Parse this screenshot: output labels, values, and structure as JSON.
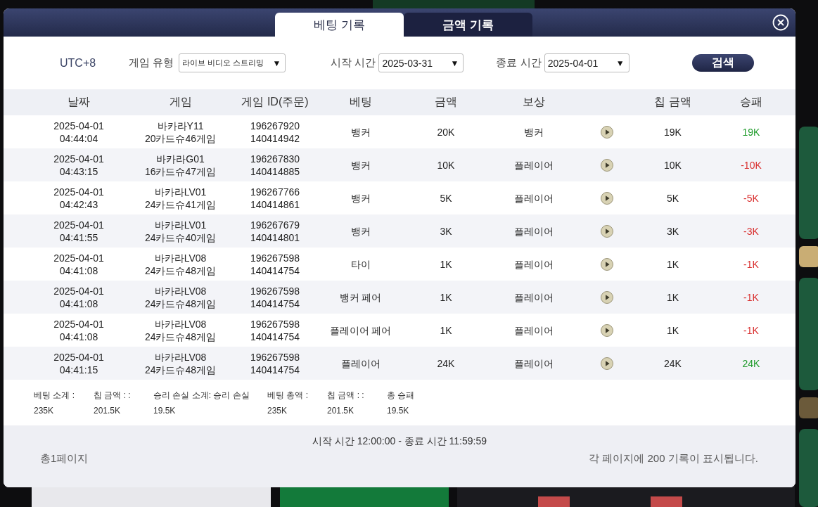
{
  "tabs": [
    {
      "label": "베팅 기록",
      "selected": true
    },
    {
      "label": "금액 기록",
      "selected": false
    }
  ],
  "filters": {
    "timezone": "UTC+8",
    "game_type_label": "게임 유형",
    "game_type": "라이브 비디오 스트리밍",
    "start_label": "시작 시간",
    "start_date": "2025-03-31",
    "end_label": "종료 시간",
    "end_date": "2025-04-01",
    "search_button": "검색",
    "dropdown_arrow": "▼"
  },
  "table": {
    "columns": [
      "날짜",
      "게임",
      "게임 ID(주문)",
      "베팅",
      "금액",
      "보상",
      "칩 금액",
      "승패"
    ],
    "rows": [
      {
        "date": "2025-04-01",
        "time": "04:44:04",
        "game": "바카라Y11",
        "shoe": "20카드슈46게임",
        "id1": "196267920",
        "id2": "140414942",
        "bet": "뱅커",
        "amount": "20K",
        "result": "뱅커",
        "chip": "19K",
        "win_loss": "19K",
        "win": true
      },
      {
        "date": "2025-04-01",
        "time": "04:43:15",
        "game": "바카라G01",
        "shoe": "16카드슈47게임",
        "id1": "196267830",
        "id2": "140414885",
        "bet": "뱅커",
        "amount": "10K",
        "result": "플레이어",
        "chip": "10K",
        "win_loss": "-10K",
        "win": false
      },
      {
        "date": "2025-04-01",
        "time": "04:42:43",
        "game": "바카라LV01",
        "shoe": "24카드슈41게임",
        "id1": "196267766",
        "id2": "140414861",
        "bet": "뱅커",
        "amount": "5K",
        "result": "플레이어",
        "chip": "5K",
        "win_loss": "-5K",
        "win": false
      },
      {
        "date": "2025-04-01",
        "time": "04:41:55",
        "game": "바카라LV01",
        "shoe": "24카드슈40게임",
        "id1": "196267679",
        "id2": "140414801",
        "bet": "뱅커",
        "amount": "3K",
        "result": "플레이어",
        "chip": "3K",
        "win_loss": "-3K",
        "win": false
      },
      {
        "date": "2025-04-01",
        "time": "04:41:08",
        "game": "바카라LV08",
        "shoe": "24카드슈48게임",
        "id1": "196267598",
        "id2": "140414754",
        "bet": "타이",
        "amount": "1K",
        "result": "플레이어",
        "chip": "1K",
        "win_loss": "-1K",
        "win": false
      },
      {
        "date": "2025-04-01",
        "time": "04:41:08",
        "game": "바카라LV08",
        "shoe": "24카드슈48게임",
        "id1": "196267598",
        "id2": "140414754",
        "bet": "뱅커 페어",
        "amount": "1K",
        "result": "플레이어",
        "chip": "1K",
        "win_loss": "-1K",
        "win": false
      },
      {
        "date": "2025-04-01",
        "time": "04:41:08",
        "game": "바카라LV08",
        "shoe": "24카드슈48게임",
        "id1": "196267598",
        "id2": "140414754",
        "bet": "플레이어 페어",
        "amount": "1K",
        "result": "플레이어",
        "chip": "1K",
        "win_loss": "-1K",
        "win": false
      },
      {
        "date": "2025-04-01",
        "time": "04:41:15",
        "game": "바카라LV08",
        "shoe": "24카드슈48게임",
        "id1": "196267598",
        "id2": "140414754",
        "bet": "플레이어",
        "amount": "24K",
        "result": "플레이어",
        "chip": "24K",
        "win_loss": "24K",
        "win": true
      }
    ]
  },
  "summary": [
    {
      "label": "베팅 소계 :",
      "value": "235K"
    },
    {
      "label": "칩 금액 : :",
      "value": "201.5K"
    },
    {
      "label": "승리 손실 소계: 승리 손실",
      "value": "19.5K"
    },
    {
      "label": "베팅 총액 :",
      "value": "235K"
    },
    {
      "label": "칩 금액 : :",
      "value": "201.5K"
    },
    {
      "label": "총 승패",
      "value": "19.5K"
    }
  ],
  "footer": {
    "time_range": "시작 시간 12:00:00 - 종료 시간 11:59:59",
    "pages": "총1페이지",
    "per_page": "각 페이지에 200 기록이 표시됩니다."
  }
}
